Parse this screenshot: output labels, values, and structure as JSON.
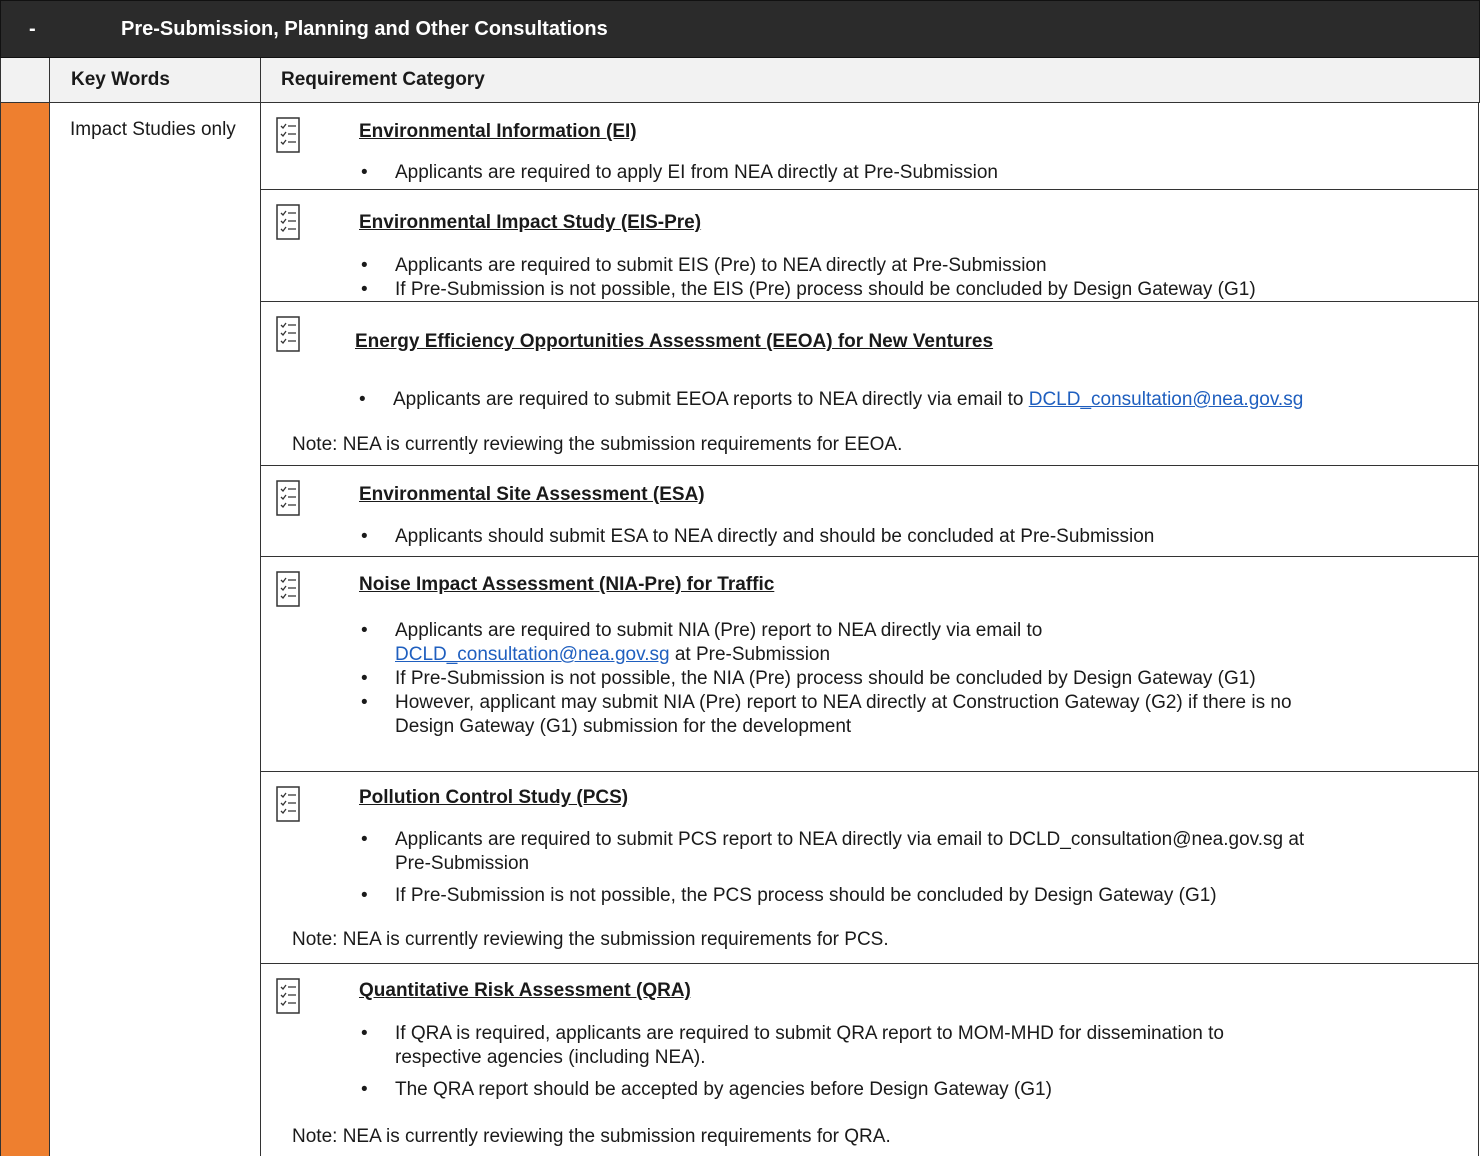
{
  "section": {
    "toggle": "-",
    "title": "Pre-Submission,  Planning and Other Consultations"
  },
  "columns": {
    "key_words": "Key Words",
    "requirement_category": "Requirement Category"
  },
  "key_words_value": "Impact Studies only",
  "colors": {
    "accent_strip": "#ee7f2f",
    "header_bar": "#2b2b2b",
    "link": "#1f5fbf"
  },
  "icon_name": "checklist-icon",
  "entries": [
    {
      "heading": "Environmental Information (EI)",
      "bullets": [
        "Applicants are required to apply EI from NEA directly at Pre-Submission"
      ],
      "note": ""
    },
    {
      "heading": "Environmental Impact Study (EIS-Pre)",
      "bullets": [
        "Applicants are required to submit EIS (Pre) to NEA directly at Pre-Submission",
        "If Pre-Submission is not possible, the EIS (Pre) process should be concluded by Design Gateway (G1)"
      ],
      "note": ""
    },
    {
      "heading": "Energy Efficiency Opportunities Assessment (EEOA) for New Ventures",
      "bullet_prefix": "Applicants are required to submit EEOA reports to NEA directly via email to ",
      "bullet_link": "DCLD_consultation@nea.gov.sg",
      "note": "Note: NEA is currently reviewing the submission requirements for EEOA."
    },
    {
      "heading": "Environmental Site Assessment (ESA)",
      "bullets": [
        "Applicants should submit ESA to NEA directly and should be concluded at Pre-Submission"
      ],
      "note": ""
    },
    {
      "heading": "Noise Impact Assessment (NIA-Pre) for Traffic",
      "bullet1_line1": "Applicants are required to submit NIA (Pre) report to NEA directly via email to",
      "bullet1_link": "DCLD_consultation@nea.gov.sg",
      "bullet1_suffix": " at Pre-Submission",
      "bullet2": "If Pre-Submission is not possible, the NIA (Pre) process should be concluded by Design Gateway (G1)",
      "bullet3_line1": "However, applicant may submit NIA (Pre) report to NEA directly at Construction Gateway (G2) if there is no",
      "bullet3_line2": "Design Gateway (G1) submission for the development",
      "note": ""
    },
    {
      "heading": "Pollution Control Study (PCS)",
      "bullet1_line1": "Applicants are required to submit PCS report to NEA directly via email to DCLD_consultation@nea.gov.sg at",
      "bullet1_line2": "Pre-Submission",
      "bullet2": "If Pre-Submission is not possible, the PCS process should be concluded by Design Gateway (G1)",
      "note": "Note: NEA is currently reviewing the submission requirements for PCS."
    },
    {
      "heading": "Quantitative Risk Assessment (QRA)",
      "bullet1_line1": "If QRA is required, applicants are required to submit QRA report to MOM-MHD for dissemination to",
      "bullet1_line2": "respective agencies (including NEA).",
      "bullet2": "The QRA report should be accepted by agencies before Design Gateway (G1)",
      "note": "Note: NEA is currently reviewing the submission requirements for QRA."
    }
  ]
}
